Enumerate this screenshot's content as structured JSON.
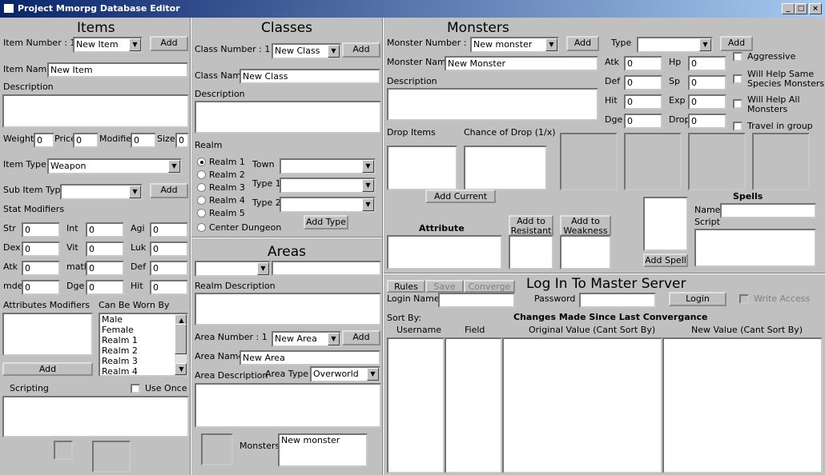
{
  "window": {
    "title": "Project Mmorpg Database Editor",
    "min": "_",
    "max": "□",
    "close": "×"
  },
  "items": {
    "heading": "Items",
    "number_label": "Item Number : 1",
    "item_select": "New Item",
    "add": "Add",
    "name_label": "Item Name",
    "name_value": "New Item",
    "description_label": "Description",
    "weight_label": "Weight",
    "weight": "0",
    "price_label": "Price",
    "price": "0",
    "modifier_label": "Modifier",
    "modifier": "0",
    "size_label": "Size",
    "size": "0",
    "type_label": "Item Type",
    "type_value": "Weapon",
    "subtype_label": "Sub Item Type",
    "subtype_value": "",
    "subtype_add": "Add",
    "stat_label": "Stat Modifiers",
    "stats": {
      "str": "Str",
      "int": "Int",
      "agi": "Agi",
      "dex": "Dex",
      "vit": "Vit",
      "luk": "Luk",
      "atk": "Atk",
      "matk": "matk",
      "def": "Def",
      "mdef": "mdef",
      "dge": "Dge",
      "hit": "Hit",
      "zero": "0"
    },
    "attr_label": "Attributes Modifiers",
    "worn_label": "Can Be Worn By",
    "worn_list": [
      "Male",
      "Female",
      "Realm 1",
      "Realm 2",
      "Realm 3",
      "Realm 4"
    ],
    "attr_add": "Add",
    "scripting_label": "Scripting",
    "use_once": "Use Once"
  },
  "classes": {
    "heading": "Classes",
    "number_label": "Class Number : 1",
    "class_select": "New Class",
    "add": "Add",
    "name_label": "Class Name",
    "name_value": "New Class",
    "description_label": "Description",
    "realm_label": "Realm",
    "realms": [
      "Realm 1",
      "Realm 2",
      "Realm 3",
      "Realm 4",
      "Realm 5",
      "Center Dungeon"
    ],
    "town_label": "Town",
    "type1_label": "Type 1",
    "type2_label": "Type 2",
    "add_type": "Add Type"
  },
  "areas": {
    "heading": "Areas",
    "realm_desc_label": "Realm Description",
    "number_label": "Area Number : 1",
    "area_select": "New Area",
    "add": "Add",
    "name_label": "Area Name",
    "name_value": "New Area",
    "desc_label": "Area Description",
    "type_label": "Area Type",
    "type_value": "Overworld",
    "monsters_label": "Monsters",
    "monsters_list": [
      "New monster"
    ]
  },
  "monsters": {
    "heading": "Monsters",
    "number_label": "Monster Number : 1",
    "monster_select": "New monster",
    "add": "Add",
    "type_label": "Type",
    "type_add": "Add",
    "name_label": "Monster Name",
    "name_value": "New Monster",
    "description_label": "Description",
    "stats": {
      "atk": "Atk",
      "hp": "Hp",
      "def": "Def",
      "sp": "Sp",
      "hit": "Hit",
      "exp": "Exp",
      "dge": "Dge",
      "drop": "Drop",
      "zero": "0"
    },
    "checks": {
      "aggressive": "Aggressive",
      "help_same_1": "Will Help Same",
      "help_same_2": "Species Monsters",
      "help_all_1": "Will Help All",
      "help_all_2": "Monsters",
      "travel": "Travel in group"
    },
    "drop_items_label": "Drop Items",
    "chance_label": "Chance of Drop (1/x)",
    "add_current": "Add Current Item",
    "attribute_label": "Attribute",
    "resistant_1": "Add  to",
    "resistant_2": "Resistant",
    "weakness_1": "Add to",
    "weakness_2": "Weakness",
    "spells_label": "Spells",
    "spell_name_label": "Name",
    "spell_script_label": "Script",
    "add_spell": "Add Spell"
  },
  "server": {
    "heading": "Log In To Master Server",
    "rules": "Rules",
    "save": "Save",
    "converge": "Converge",
    "login_name_label": "Login Name",
    "password_label": "Password",
    "login": "Login",
    "write_access": "Write Access",
    "sort_by": "Sort By:",
    "changes_label": "Changes Made Since Last Convergance",
    "columns": [
      "Username",
      "Field",
      "Original Value (Cant Sort By)",
      "New Value (Cant Sort By)"
    ]
  }
}
